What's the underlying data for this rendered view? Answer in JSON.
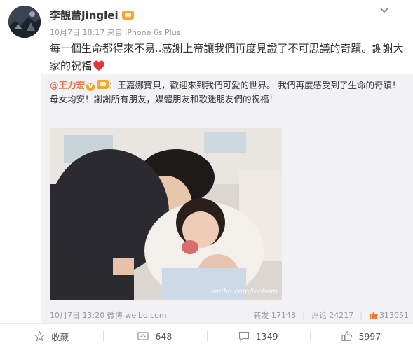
{
  "post": {
    "author": "李靚蕾Jinglei",
    "date": "10月7日 18:17",
    "source_prefix": "来自",
    "source": "iPhone 6s Plus",
    "text": "每一個生命都得來不易..感謝上帝讓我們再度見證了不可思議的奇蹟。謝謝大家的祝福"
  },
  "repost": {
    "mention": "@王力宏",
    "text": "：王嘉娜寶貝，歡迎來到我們可愛的世界。 我們再度感受到了生命的奇蹟！ 母女均安！謝謝所有朋友，媒體朋友和歌迷朋友們的祝福！",
    "watermark": "weibo.com/leehom",
    "date": "10月7日 13:20",
    "client": "微博 weibo.com",
    "repost_label": "转发 17148",
    "comment_label": "评论 24217",
    "like_count": "313051"
  },
  "actions": {
    "collect": "收藏",
    "repost": "648",
    "comment": "1349",
    "like": "5997"
  },
  "colors": {
    "accent": "#eb7350",
    "vip": "#f7a731",
    "heart": "#e3353b",
    "repost_bg": "#f2f2f5"
  }
}
